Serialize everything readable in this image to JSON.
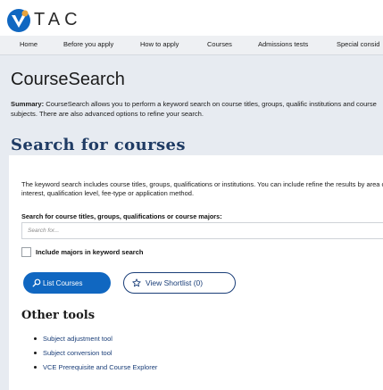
{
  "logo": {
    "text": "TAC",
    "icon": "vtac-logo-icon"
  },
  "nav": {
    "items": [
      {
        "label": "Home"
      },
      {
        "label": "Before you apply"
      },
      {
        "label": "How to apply"
      },
      {
        "label": "Courses"
      },
      {
        "label": "Admissions tests"
      },
      {
        "label": "Special consid"
      }
    ]
  },
  "hero": {
    "title": "CourseSearch",
    "summary_label": "Summary:",
    "summary_text": " CourseSearch allows you to perform a keyword search on course titles, groups, qualific institutions and course subjects. There are also advanced options to refine your search."
  },
  "search": {
    "section_title": "Search for courses",
    "description": "The keyword search includes course titles, groups, qualifications or institutions. You can include refine the results by area of interest, qualification level, fee-type or application method.",
    "label": "Search for course titles, groups, qualifications or course majors:",
    "placeholder": "Search for...",
    "value": "",
    "include_majors_label": "Include majors in keyword search",
    "include_majors_checked": false
  },
  "buttons": {
    "list_courses": "List Courses",
    "view_shortlist": "View Shortlist (0)",
    "list_icon": "search-icon",
    "shortlist_icon": "star-icon"
  },
  "tools": {
    "title": "Other tools",
    "links": [
      {
        "label": "Subject adjustment tool"
      },
      {
        "label": "Subject conversion tool"
      },
      {
        "label": "VCE Prerequisite and Course Explorer"
      }
    ]
  },
  "colors": {
    "brand_blue": "#1067c1",
    "heading_navy": "#1f3b64",
    "hero_bg": "#e7ebf1"
  }
}
